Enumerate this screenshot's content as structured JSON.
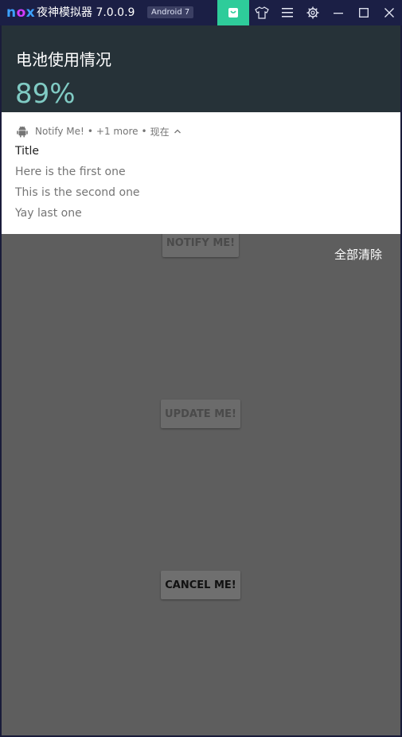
{
  "emulator": {
    "logo": "nox",
    "title": "夜神模拟器 7.0.0.9",
    "android_badge": "Android 7",
    "accent_color": "#2ecc9a"
  },
  "quick_settings": {
    "title": "电池使用情况",
    "value": "89%"
  },
  "notification": {
    "app_name": "Notify Me!",
    "more": "+1 more",
    "time": "现在",
    "title": "Title",
    "lines": [
      "Here is the first one",
      "This is the second one",
      "Yay last one"
    ]
  },
  "clear_all_label": "全部清除",
  "app_buttons": {
    "notify": "NOTIFY ME!",
    "update": "UPDATE ME!",
    "cancel": "CANCEL ME!"
  }
}
